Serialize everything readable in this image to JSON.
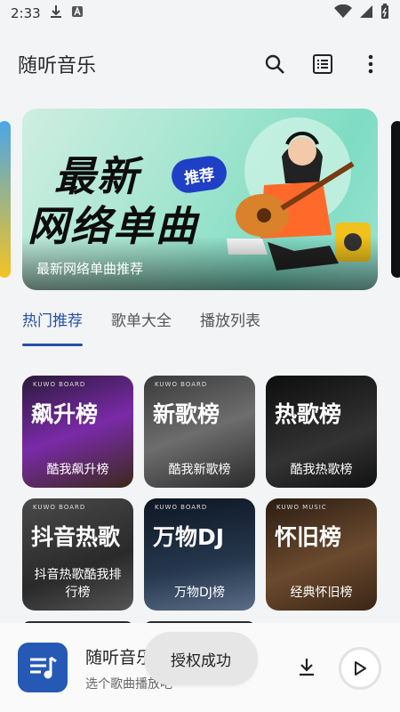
{
  "status": {
    "time": "2:33"
  },
  "appbar": {
    "title": "随听音乐"
  },
  "banner": {
    "line1": "最新",
    "line2": "网络单曲",
    "badge": "推荐",
    "caption": "最新网络单曲推荐"
  },
  "tabs": [
    {
      "label": "热门推荐",
      "active": true
    },
    {
      "label": "歌单大全",
      "active": false
    },
    {
      "label": "播放列表",
      "active": false
    }
  ],
  "charts": [
    {
      "title": "飙升榜",
      "subtitle": "酷我飙升榜",
      "board": "KUWO BOARD",
      "bg": "#6a3a8a"
    },
    {
      "title": "新歌榜",
      "subtitle": "酷我新歌榜",
      "board": "KUWO BOARD",
      "bg": "#5a5a5a"
    },
    {
      "title": "热歌榜",
      "subtitle": "酷我热歌榜",
      "board": "",
      "bg": "#1a1a1a"
    },
    {
      "title": "抖音热歌",
      "subtitle": "抖音热歌酷我排行榜",
      "board": "KUWO BOARD",
      "bg": "#3a3a3a"
    },
    {
      "title": "万物DJ",
      "subtitle": "万物DJ榜",
      "board": "KUWO BOARD",
      "bg": "#1d2b3e"
    },
    {
      "title": "怀旧榜",
      "subtitle": "经典怀旧榜",
      "board": "KUWO MUSIC",
      "bg": "#5a3d28"
    }
  ],
  "player": {
    "title": "随听音乐",
    "subtitle": "选个歌曲播放吧"
  },
  "toast": "授权成功",
  "colors": {
    "accent": "#2450a6",
    "cover": "#2559b5"
  }
}
